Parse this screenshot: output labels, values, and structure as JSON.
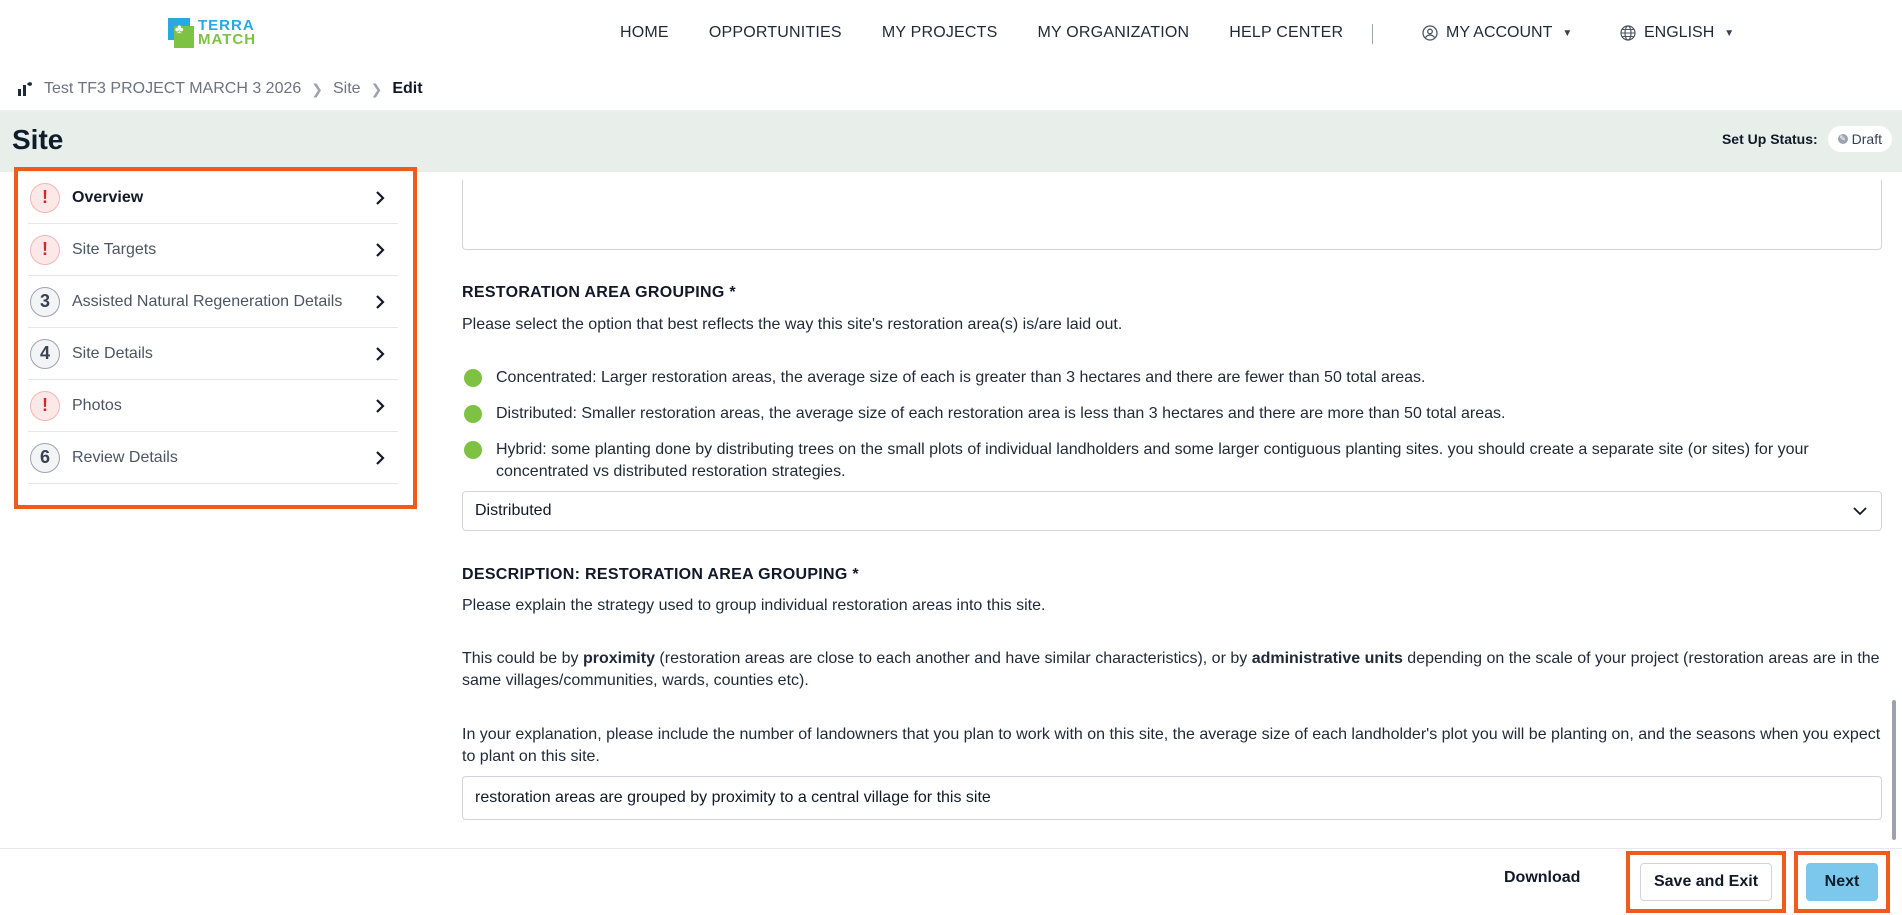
{
  "nav": {
    "logo_line1": "TERRA",
    "logo_line2": "MATCH",
    "links": [
      "HOME",
      "OPPORTUNITIES",
      "MY PROJECTS",
      "MY ORGANIZATION",
      "HELP CENTER"
    ],
    "account": "MY ACCOUNT",
    "language": "ENGLISH"
  },
  "breadcrumb": {
    "project": "Test TF3 PROJECT MARCH 3 2026",
    "section": "Site",
    "current": "Edit"
  },
  "header": {
    "title": "Site",
    "status_label": "Set Up Status:",
    "status_value": "Draft"
  },
  "sidebar": {
    "steps": [
      {
        "icon": "!",
        "label": "Overview",
        "state": "error"
      },
      {
        "icon": "!",
        "label": "Site Targets",
        "state": "error"
      },
      {
        "icon": "3",
        "label": "Assisted Natural Regeneration Details",
        "state": "number"
      },
      {
        "icon": "4",
        "label": "Site Details",
        "state": "number"
      },
      {
        "icon": "!",
        "label": "Photos",
        "state": "error"
      },
      {
        "icon": "6",
        "label": "Review Details",
        "state": "number"
      }
    ]
  },
  "form": {
    "grouping_title": "RESTORATION AREA GROUPING *",
    "grouping_help": "Please select the option that best reflects the way this site's restoration area(s) is/are laid out.",
    "options": [
      "Concentrated: Larger restoration areas, the average size of each is greater than 3 hectares and there are fewer than 50 total areas.",
      "Distributed: Smaller restoration areas, the average size of each restoration area is less than 3 hectares and there are more than 50 total areas.",
      "Hybrid: some planting done by distributing trees on the small plots of individual landholders and some larger contiguous planting sites. you should create a separate site (or sites) for your concentrated vs distributed restoration strategies."
    ],
    "grouping_selected": "Distributed",
    "description_title": "DESCRIPTION: RESTORATION AREA GROUPING *",
    "description_help1": "Please explain the strategy used to group individual restoration areas into this site.",
    "description_help2_pre": "This could be by ",
    "description_help2_bold1": "proximity",
    "description_help2_mid": " (restoration areas are close to each another and have similar characteristics), or by ",
    "description_help2_bold2": "administrative units",
    "description_help2_post": " depending on the scale of your project (restoration areas are in the same villages/communities, wards, counties etc).",
    "description_help3": "In your explanation, please include the number of landowners that you plan to work with on this site, the average size of each landholder's plot you will be planting on, and the seasons when you expect to plant on this site.",
    "description_value": "restoration areas are grouped by proximity to a central village for this site"
  },
  "footer": {
    "download": "Download",
    "save_exit": "Save and Exit",
    "next": "Next"
  },
  "colors": {
    "accent_highlight": "#f05a1a",
    "header_band": "#e8efeb",
    "option_dot": "#7dc242",
    "next_button": "#7cc7ec",
    "error_icon": "#d9232d"
  }
}
